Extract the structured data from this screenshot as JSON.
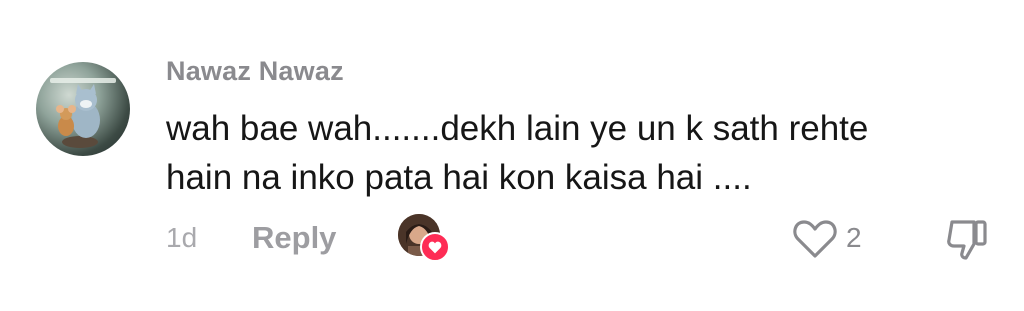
{
  "comment": {
    "author": "Nawaz Nawaz",
    "text_line1": "wah bae wah.......dekh lain ye un k sath rehte",
    "text_line2": "hain na inko pata hai kon kaisa hai ....",
    "time": "1d",
    "reply_label": "Reply",
    "like_count": "2",
    "avatar_icon": "cartoon-cat-mouse-avatar",
    "creator_like_icon": "creator-heart-badge",
    "like_icon": "heart-outline-icon",
    "dislike_icon": "thumbs-down-icon",
    "colors": {
      "author": "#8a8a8e",
      "text": "#161616",
      "meta": "#a9a9ad",
      "heart_badge": "#fe2c55"
    }
  }
}
